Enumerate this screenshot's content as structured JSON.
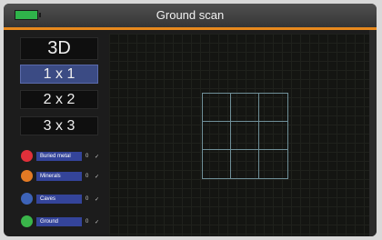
{
  "window": {
    "title": "Ground scan"
  },
  "colors": {
    "accent": "#e7891e",
    "active_button": "#3b4b84",
    "battery": "#2fb34a"
  },
  "sidebar": {
    "view_label": "3D",
    "grid_options": [
      {
        "label": "1 x 1",
        "active": true
      },
      {
        "label": "2 x 2",
        "active": false
      },
      {
        "label": "3 x 3",
        "active": false
      }
    ],
    "legend": [
      {
        "label": "Buried metal",
        "color": "#e0303a",
        "count": "0"
      },
      {
        "label": "Minerals",
        "color": "#e37a24",
        "count": "0"
      },
      {
        "label": "Caves",
        "color": "#3d63b8",
        "count": "0"
      },
      {
        "label": "Ground",
        "color": "#3ab54a",
        "count": "0"
      }
    ]
  },
  "icons": {
    "battery": "battery-icon",
    "toggle": "check-icon"
  },
  "scan_grid": {
    "rows": 3,
    "cols": 3
  }
}
